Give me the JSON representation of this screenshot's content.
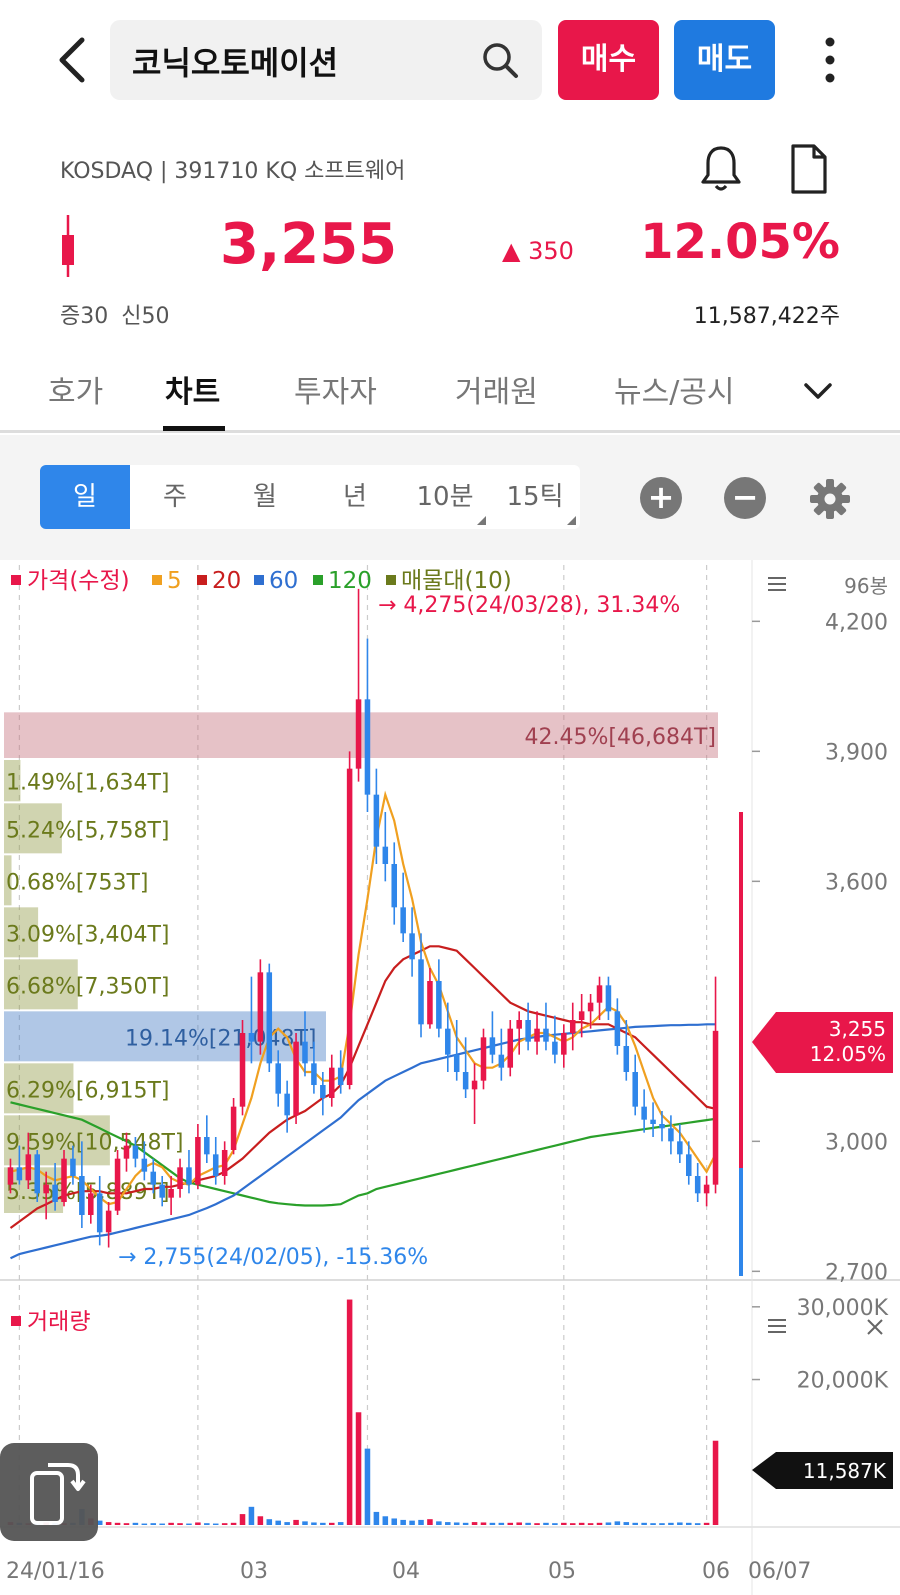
{
  "header": {
    "search_text": "코닉오토메이션",
    "buy_label": "매수",
    "sell_label": "매도"
  },
  "stock": {
    "meta": "KOSDAQ | 391710 KQ 소프트웨어",
    "price": "3,255",
    "change": "▲ 350",
    "change_pct": "12.05%",
    "margin_info": "증30 신50",
    "volume": "11,587,422주"
  },
  "tabs": [
    {
      "label": "호가"
    },
    {
      "label": "차트"
    },
    {
      "label": "투자자"
    },
    {
      "label": "거래원"
    },
    {
      "label": "뉴스/공시"
    }
  ],
  "periods": [
    {
      "label": "일"
    },
    {
      "label": "주"
    },
    {
      "label": "월"
    },
    {
      "label": "년"
    },
    {
      "label": "10분"
    },
    {
      "label": "15틱"
    }
  ],
  "colors": {
    "up": "#e8174a",
    "down": "#2f86ea",
    "ma5": "#f0a020",
    "ma20": "#c81e1e",
    "ma60": "#2f6fd0",
    "ma120": "#2aa02a",
    "volume_profile": "#6b7a1c"
  },
  "chart_data": [
    {
      "type": "candlestick",
      "title": "",
      "legend": [
        "가격(수정)",
        "5",
        "20",
        "60",
        "120",
        "매물대(10)"
      ],
      "bar_count_label": "96봉",
      "y_ticks": [
        4200,
        3900,
        3600,
        3000,
        2700
      ],
      "y_tick_labels": [
        "4,200",
        "3,900",
        "3,600",
        "3,000",
        "2,700"
      ],
      "ylim": [
        2680,
        4330
      ],
      "x_labels": [
        "24/01/16",
        "03",
        "04",
        "05",
        "06",
        "06/07"
      ],
      "current_price_tag": [
        "3,255",
        "12.05%"
      ],
      "annotations": {
        "high": "→ 4,275(24/03/28), 31.34%",
        "low": "→ 2,755(24/02/05), -15.36%"
      },
      "volume_profile": [
        {
          "label": "42.45%[46,684T]",
          "low": 3880,
          "high": 3990,
          "share": 42.45,
          "highlight": "max"
        },
        {
          "label": "1.49%[1,634T]",
          "low": 3780,
          "high": 3880,
          "share": 1.49
        },
        {
          "label": "5.24%[5,758T]",
          "low": 3660,
          "high": 3780,
          "share": 5.24
        },
        {
          "label": "0.68%[753T]",
          "low": 3540,
          "high": 3660,
          "share": 0.68
        },
        {
          "label": "3.09%[3,404T]",
          "low": 3420,
          "high": 3540,
          "share": 3.09
        },
        {
          "label": "6.68%[7,350T]",
          "low": 3300,
          "high": 3420,
          "share": 6.68
        },
        {
          "label": "19.14%[21,048T]",
          "low": 3180,
          "high": 3300,
          "share": 19.14,
          "highlight": "current"
        },
        {
          "label": "6.29%[6,915T]",
          "low": 3060,
          "high": 3180,
          "share": 6.29
        },
        {
          "label": "9.59%[10,548T]",
          "low": 2940,
          "high": 3060,
          "share": 9.59
        },
        {
          "label": "5.35%[5,889T]",
          "low": 2830,
          "high": 2940,
          "share": 5.35
        }
      ],
      "candles": [
        [
          2900,
          2960,
          2880,
          2940
        ],
        [
          2940,
          2990,
          2900,
          2910
        ],
        [
          2910,
          3020,
          2890,
          2970
        ],
        [
          2970,
          2980,
          2860,
          2880
        ],
        [
          2880,
          2930,
          2820,
          2900
        ],
        [
          2900,
          2950,
          2840,
          2860
        ],
        [
          2860,
          2980,
          2850,
          2960
        ],
        [
          2960,
          2990,
          2900,
          2920
        ],
        [
          2920,
          3000,
          2800,
          2830
        ],
        [
          2830,
          2900,
          2810,
          2880
        ],
        [
          2880,
          2920,
          2760,
          2790
        ],
        [
          2790,
          2860,
          2755,
          2840
        ],
        [
          2840,
          2980,
          2830,
          2960
        ],
        [
          2960,
          3020,
          2930,
          2990
        ],
        [
          2990,
          3010,
          2940,
          2960
        ],
        [
          2960,
          3000,
          2910,
          2930
        ],
        [
          2930,
          2960,
          2880,
          2900
        ],
        [
          2900,
          2920,
          2850,
          2870
        ],
        [
          2870,
          2920,
          2830,
          2890
        ],
        [
          2890,
          2960,
          2870,
          2940
        ],
        [
          2940,
          2980,
          2880,
          2900
        ],
        [
          2900,
          3040,
          2890,
          3010
        ],
        [
          3010,
          3060,
          2950,
          2970
        ],
        [
          2970,
          3010,
          2900,
          2920
        ],
        [
          2920,
          3000,
          2900,
          2980
        ],
        [
          2980,
          3100,
          2970,
          3080
        ],
        [
          3080,
          3280,
          3060,
          3250
        ],
        [
          3250,
          3380,
          3180,
          3230
        ],
        [
          3230,
          3420,
          3200,
          3390
        ],
        [
          3390,
          3410,
          3160,
          3180
        ],
        [
          3180,
          3210,
          3080,
          3110
        ],
        [
          3110,
          3140,
          3020,
          3060
        ],
        [
          3060,
          3250,
          3040,
          3230
        ],
        [
          3230,
          3300,
          3150,
          3180
        ],
        [
          3180,
          3230,
          3110,
          3130
        ],
        [
          3130,
          3160,
          3060,
          3100
        ],
        [
          3100,
          3200,
          3080,
          3170
        ],
        [
          3170,
          3210,
          3110,
          3130
        ],
        [
          3130,
          3900,
          3120,
          3860
        ],
        [
          3860,
          4275,
          3830,
          4020
        ],
        [
          4020,
          4160,
          3760,
          3800
        ],
        [
          3800,
          3860,
          3640,
          3680
        ],
        [
          3680,
          3760,
          3600,
          3640
        ],
        [
          3640,
          3690,
          3500,
          3540
        ],
        [
          3540,
          3620,
          3460,
          3480
        ],
        [
          3480,
          3540,
          3380,
          3420
        ],
        [
          3420,
          3480,
          3240,
          3270
        ],
        [
          3270,
          3400,
          3260,
          3370
        ],
        [
          3370,
          3420,
          3240,
          3260
        ],
        [
          3260,
          3320,
          3160,
          3200
        ],
        [
          3200,
          3280,
          3140,
          3160
        ],
        [
          3160,
          3240,
          3100,
          3120
        ],
        [
          3120,
          3180,
          3040,
          3140
        ],
        [
          3140,
          3260,
          3120,
          3240
        ],
        [
          3240,
          3300,
          3180,
          3200
        ],
        [
          3200,
          3260,
          3140,
          3170
        ],
        [
          3170,
          3280,
          3150,
          3260
        ],
        [
          3260,
          3300,
          3200,
          3280
        ],
        [
          3280,
          3320,
          3210,
          3230
        ],
        [
          3230,
          3300,
          3200,
          3260
        ],
        [
          3260,
          3320,
          3210,
          3230
        ],
        [
          3230,
          3290,
          3180,
          3200
        ],
        [
          3200,
          3270,
          3170,
          3250
        ],
        [
          3250,
          3320,
          3210,
          3280
        ],
        [
          3280,
          3340,
          3240,
          3300
        ],
        [
          3300,
          3340,
          3260,
          3320
        ],
        [
          3320,
          3380,
          3280,
          3360
        ],
        [
          3360,
          3380,
          3280,
          3300
        ],
        [
          3300,
          3330,
          3200,
          3220
        ],
        [
          3220,
          3280,
          3140,
          3160
        ],
        [
          3160,
          3200,
          3060,
          3080
        ],
        [
          3080,
          3120,
          3020,
          3050
        ],
        [
          3050,
          3090,
          3010,
          3040
        ],
        [
          3040,
          3070,
          3000,
          3030
        ],
        [
          3030,
          3060,
          2970,
          3000
        ],
        [
          3000,
          3040,
          2950,
          2970
        ],
        [
          2970,
          3000,
          2900,
          2920
        ],
        [
          2920,
          2950,
          2860,
          2880
        ],
        [
          2880,
          2920,
          2850,
          2900
        ],
        [
          2900,
          3380,
          2880,
          3255
        ]
      ],
      "ma5": [
        2930,
        2935,
        2940,
        2935,
        2920,
        2910,
        2915,
        2920,
        2910,
        2890,
        2870,
        2855,
        2860,
        2890,
        2920,
        2940,
        2950,
        2940,
        2915,
        2905,
        2900,
        2920,
        2930,
        2940,
        2945,
        2980,
        3040,
        3100,
        3180,
        3240,
        3260,
        3240,
        3190,
        3160,
        3160,
        3140,
        3140,
        3150,
        3270,
        3430,
        3560,
        3700,
        3800,
        3740,
        3640,
        3560,
        3460,
        3400,
        3360,
        3300,
        3240,
        3210,
        3180,
        3170,
        3170,
        3180,
        3200,
        3230,
        3240,
        3250,
        3250,
        3240,
        3230,
        3240,
        3260,
        3270,
        3290,
        3310,
        3300,
        3270,
        3220,
        3160,
        3100,
        3060,
        3040,
        3020,
        2990,
        2960,
        2930,
        2970
      ],
      "ma20": [
        2800,
        2815,
        2830,
        2845,
        2855,
        2865,
        2875,
        2880,
        2885,
        2885,
        2885,
        2880,
        2880,
        2880,
        2885,
        2890,
        2890,
        2895,
        2895,
        2900,
        2905,
        2910,
        2915,
        2920,
        2930,
        2945,
        2960,
        2980,
        3000,
        3020,
        3035,
        3050,
        3060,
        3070,
        3085,
        3100,
        3110,
        3130,
        3170,
        3220,
        3270,
        3320,
        3370,
        3400,
        3420,
        3430,
        3440,
        3450,
        3450,
        3445,
        3440,
        3420,
        3400,
        3380,
        3360,
        3340,
        3320,
        3310,
        3300,
        3295,
        3290,
        3285,
        3280,
        3275,
        3275,
        3270,
        3270,
        3270,
        3260,
        3250,
        3240,
        3220,
        3200,
        3180,
        3160,
        3140,
        3120,
        3100,
        3080,
        3075
      ],
      "ma60": [
        2730,
        2740,
        2745,
        2750,
        2755,
        2760,
        2765,
        2770,
        2775,
        2780,
        2782,
        2785,
        2790,
        2795,
        2800,
        2805,
        2810,
        2815,
        2820,
        2825,
        2830,
        2838,
        2846,
        2855,
        2865,
        2875,
        2890,
        2905,
        2920,
        2935,
        2950,
        2965,
        2980,
        2995,
        3010,
        3025,
        3040,
        3055,
        3075,
        3095,
        3110,
        3125,
        3140,
        3150,
        3160,
        3170,
        3180,
        3185,
        3190,
        3195,
        3200,
        3205,
        3210,
        3215,
        3220,
        3225,
        3230,
        3235,
        3238,
        3241,
        3244,
        3246,
        3248,
        3250,
        3252,
        3254,
        3256,
        3258,
        3260,
        3262,
        3264,
        3265,
        3266,
        3267,
        3268,
        3268,
        3269,
        3269,
        3270,
        3270
      ],
      "ma120": [
        3090,
        3085,
        3080,
        3075,
        3070,
        3065,
        3060,
        3055,
        3050,
        3040,
        3030,
        3020,
        3010,
        3000,
        2990,
        2975,
        2960,
        2945,
        2930,
        2915,
        2905,
        2900,
        2895,
        2890,
        2885,
        2880,
        2875,
        2870,
        2865,
        2860,
        2857,
        2855,
        2853,
        2852,
        2852,
        2852,
        2853,
        2855,
        2865,
        2875,
        2880,
        2890,
        2895,
        2900,
        2905,
        2910,
        2915,
        2920,
        2925,
        2930,
        2935,
        2940,
        2945,
        2950,
        2955,
        2960,
        2965,
        2970,
        2975,
        2980,
        2985,
        2990,
        2995,
        3000,
        3005,
        3010,
        3013,
        3016,
        3019,
        3022,
        3025,
        3028,
        3031,
        3034,
        3037,
        3040,
        3043,
        3046,
        3049,
        3052
      ]
    },
    {
      "type": "bar",
      "title": "",
      "legend": [
        "거래량"
      ],
      "y_ticks": [
        30000,
        20000
      ],
      "y_tick_labels": [
        "30,000K",
        "20,000K"
      ],
      "ylim": [
        0,
        33000
      ],
      "current_volume_tag": "11,587K",
      "values": [
        400,
        300,
        250,
        200,
        350,
        300,
        250,
        300,
        2200,
        900,
        600,
        400,
        300,
        250,
        300,
        200,
        250,
        200,
        300,
        250,
        200,
        350,
        250,
        200,
        250,
        300,
        1500,
        2500,
        1200,
        800,
        600,
        400,
        700,
        500,
        350,
        300,
        300,
        400,
        31000,
        15500,
        10500,
        1800,
        1200,
        900,
        700,
        600,
        700,
        800,
        500,
        400,
        350,
        300,
        400,
        350,
        300,
        300,
        300,
        350,
        300,
        250,
        300,
        250,
        300,
        250,
        300,
        250,
        300,
        350,
        500,
        400,
        300,
        300,
        250,
        250,
        300,
        350,
        300,
        250,
        300,
        11587
      ]
    }
  ]
}
